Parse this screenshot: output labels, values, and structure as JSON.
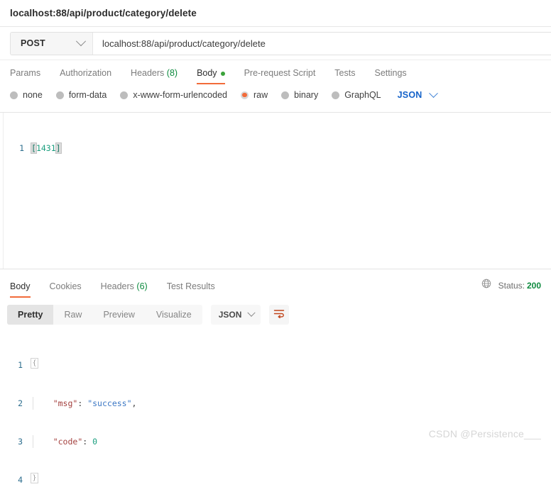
{
  "request": {
    "title": "localhost:88/api/product/category/delete",
    "method": "POST",
    "url": "localhost:88/api/product/category/delete",
    "tabs": [
      {
        "label": "Params",
        "count": "",
        "active": false
      },
      {
        "label": "Authorization",
        "count": "",
        "active": false
      },
      {
        "label": "Headers",
        "count": "(8)",
        "active": false
      },
      {
        "label": "Body",
        "count": "",
        "active": true
      },
      {
        "label": "Pre-request Script",
        "count": "",
        "active": false
      },
      {
        "label": "Tests",
        "count": "",
        "active": false
      },
      {
        "label": "Settings",
        "count": "",
        "active": false
      }
    ],
    "body_types": [
      {
        "label": "none",
        "selected": false
      },
      {
        "label": "form-data",
        "selected": false
      },
      {
        "label": "x-www-form-urlencoded",
        "selected": false
      },
      {
        "label": "raw",
        "selected": true
      },
      {
        "label": "binary",
        "selected": false
      },
      {
        "label": "GraphQL",
        "selected": false
      }
    ],
    "format_select": "JSON",
    "editor": {
      "line_number": "1",
      "open_bracket": "[",
      "value": "1431",
      "close_bracket": "]"
    }
  },
  "response": {
    "tabs": [
      {
        "label": "Body",
        "count": "",
        "active": true
      },
      {
        "label": "Cookies",
        "count": "",
        "active": false
      },
      {
        "label": "Headers",
        "count": "(6)",
        "active": false
      },
      {
        "label": "Test Results",
        "count": "",
        "active": false
      }
    ],
    "status_label": "Status:",
    "status_code": "200",
    "view_modes": [
      {
        "label": "Pretty",
        "active": true
      },
      {
        "label": "Raw",
        "active": false
      },
      {
        "label": "Preview",
        "active": false
      },
      {
        "label": "Visualize",
        "active": false
      }
    ],
    "format_select": "JSON",
    "body_lines": [
      {
        "num": "1",
        "fold": "{",
        "indent": false,
        "key": "",
        "colon": "",
        "value": "",
        "comma": ""
      },
      {
        "num": "2",
        "fold": "",
        "indent": true,
        "key": "\"msg\"",
        "colon": ":",
        "value": "\"success\"",
        "value_type": "string",
        "comma": ","
      },
      {
        "num": "3",
        "fold": "",
        "indent": true,
        "key": "\"code\"",
        "colon": ":",
        "value": "0",
        "value_type": "number",
        "comma": ""
      },
      {
        "num": "4",
        "fold": "}",
        "indent": false,
        "key": "",
        "colon": "",
        "value": "",
        "comma": ""
      }
    ]
  },
  "watermark": "CSDN @Persistence___",
  "colors": {
    "accent_orange": "#f26b3a",
    "status_green": "#0d8a3e",
    "json_blue": "#1462c9",
    "key_red": "#a4413f",
    "string_blue": "#3b77c4"
  },
  "icons": {
    "method_chevron": "chevron-down-icon",
    "format_chevron": "chevron-down-icon",
    "globe": "globe-icon",
    "wrap_lines": "wrap-lines-icon"
  }
}
